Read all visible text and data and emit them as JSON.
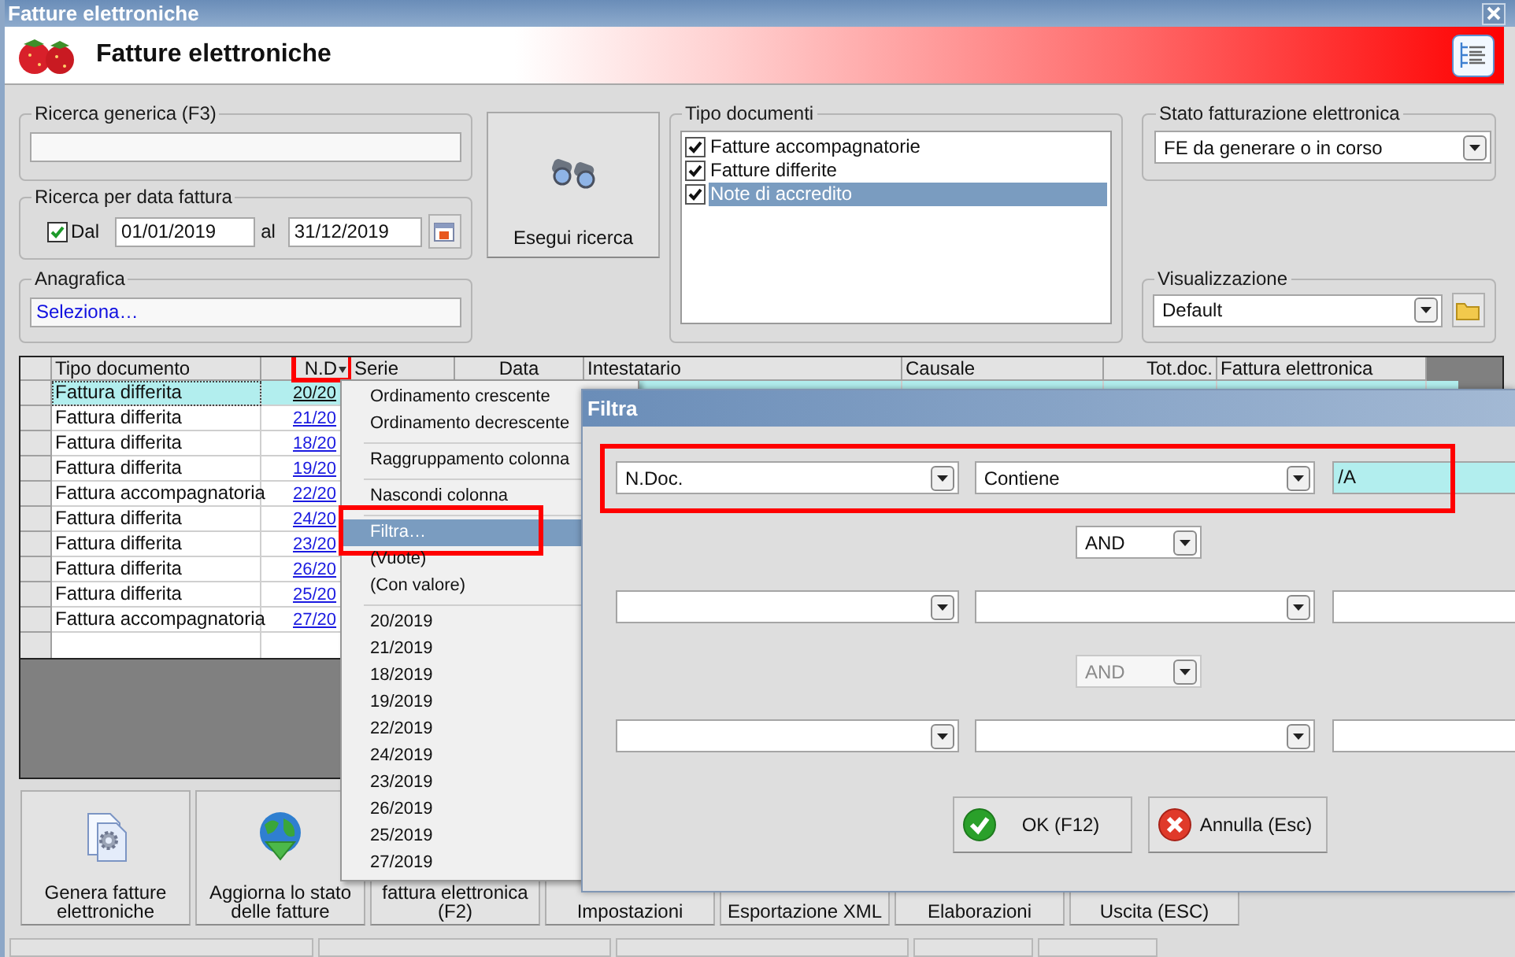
{
  "window": {
    "title": "Fatture elettroniche"
  },
  "header": {
    "title": "Fatture elettroniche"
  },
  "ricerca_generica": {
    "label": "Ricerca generica (F3)"
  },
  "ricerca_data": {
    "label": "Ricerca per data fattura",
    "dal": {
      "label": "Dal",
      "checked": true
    },
    "from": "01/01/2019",
    "al": "al",
    "to": "31/12/2019"
  },
  "anagrafica": {
    "label": "Anagrafica",
    "value": "Seleziona…"
  },
  "search_button": {
    "label": "Esegui ricerca"
  },
  "tipo_documenti": {
    "label": "Tipo documenti",
    "items": [
      {
        "label": "Fatture accompagnatorie",
        "checked": true,
        "selected": false
      },
      {
        "label": "Fatture differite",
        "checked": true,
        "selected": false
      },
      {
        "label": "Note di accredito",
        "checked": true,
        "selected": true
      }
    ]
  },
  "stato": {
    "label": "Stato fatturazione elettronica",
    "value": "FE da generare o in corso"
  },
  "visualizzazione": {
    "label": "Visualizzazione",
    "value": "Default"
  },
  "table": {
    "columns": [
      {
        "label": "Tipo documento",
        "annotated": false
      },
      {
        "label": "N.D",
        "annotated": true
      },
      {
        "label": "Serie",
        "annotated": false
      },
      {
        "label": "Data",
        "annotated": false
      },
      {
        "label": "Intestatario",
        "annotated": false
      },
      {
        "label": "Causale",
        "annotated": false
      },
      {
        "label": "Tot.doc.",
        "annotated": false
      },
      {
        "label": "Fattura elettronica",
        "annotated": false
      }
    ],
    "rows": [
      {
        "tipo": "Fattura differita",
        "n_doc": "20/20",
        "selected": true
      },
      {
        "tipo": "Fattura differita",
        "n_doc": "21/20",
        "selected": false
      },
      {
        "tipo": "Fattura differita",
        "n_doc": "18/20",
        "selected": false
      },
      {
        "tipo": "Fattura differita",
        "n_doc": "19/20",
        "selected": false
      },
      {
        "tipo": "Fattura accompagnatoria",
        "n_doc": "22/20",
        "selected": false
      },
      {
        "tipo": "Fattura differita",
        "n_doc": "24/20",
        "selected": false
      },
      {
        "tipo": "Fattura differita",
        "n_doc": "23/20",
        "selected": false
      },
      {
        "tipo": "Fattura differita",
        "n_doc": "26/20",
        "selected": false
      },
      {
        "tipo": "Fattura differita",
        "n_doc": "25/20",
        "selected": false
      },
      {
        "tipo": "Fattura accompagnatoria",
        "n_doc": "27/20",
        "selected": false
      }
    ]
  },
  "context_menu": {
    "items": [
      {
        "kind": "item",
        "label": "Ordinamento crescente",
        "selected": false,
        "annotated": false
      },
      {
        "kind": "item",
        "label": "Ordinamento decrescente",
        "selected": false,
        "annotated": false
      },
      {
        "kind": "separator"
      },
      {
        "kind": "item",
        "label": "Raggruppamento colonna",
        "selected": false,
        "annotated": false
      },
      {
        "kind": "separator"
      },
      {
        "kind": "item",
        "label": "Nascondi colonna",
        "selected": false,
        "annotated": false
      },
      {
        "kind": "separator"
      },
      {
        "kind": "item",
        "label": "Filtra…",
        "selected": true,
        "annotated": true
      },
      {
        "kind": "item",
        "label": "(Vuote)",
        "selected": false,
        "annotated": false
      },
      {
        "kind": "item",
        "label": "(Con valore)",
        "selected": false,
        "annotated": false
      },
      {
        "kind": "separator"
      },
      {
        "kind": "item",
        "label": "20/2019",
        "selected": false,
        "annotated": false
      },
      {
        "kind": "item",
        "label": "21/2019",
        "selected": false,
        "annotated": false
      },
      {
        "kind": "item",
        "label": "18/2019",
        "selected": false,
        "annotated": false
      },
      {
        "kind": "item",
        "label": "19/2019",
        "selected": false,
        "annotated": false
      },
      {
        "kind": "item",
        "label": "22/2019",
        "selected": false,
        "annotated": false
      },
      {
        "kind": "item",
        "label": "24/2019",
        "selected": false,
        "annotated": false
      },
      {
        "kind": "item",
        "label": "23/2019",
        "selected": false,
        "annotated": false
      },
      {
        "kind": "item",
        "label": "26/2019",
        "selected": false,
        "annotated": false
      },
      {
        "kind": "item",
        "label": "25/2019",
        "selected": false,
        "annotated": false
      },
      {
        "kind": "item",
        "label": "27/2019",
        "selected": false,
        "annotated": false
      }
    ]
  },
  "filter_dialog": {
    "title": "Filtra",
    "rows": [
      {
        "kind": "condition",
        "field": "N.Doc.",
        "operator": "Contiene",
        "value": "/A",
        "annotated": true
      },
      {
        "kind": "connector",
        "value": "AND",
        "disabled": false
      },
      {
        "kind": "condition",
        "annotated": false
      },
      {
        "kind": "connector",
        "value": "AND",
        "disabled": true
      },
      {
        "kind": "condition",
        "annotated": false
      }
    ],
    "buttons": [
      {
        "kind": "ok",
        "label": "OK (F12)"
      },
      {
        "kind": "cancel",
        "label": "Annulla (Esc)"
      }
    ]
  },
  "bottom_buttons": [
    {
      "kind": "generate",
      "lines": [
        "Genera fatture",
        "elettroniche"
      ]
    },
    {
      "kind": "update",
      "lines": [
        "Aggiorna lo stato",
        "delle fatture"
      ]
    },
    {
      "kind": "covered",
      "lines": [
        "fattura elettronica",
        "(F2)"
      ]
    },
    {
      "kind": "covered",
      "lines": [
        "Impostazioni"
      ]
    },
    {
      "kind": "covered",
      "lines": [
        "Esportazione XML"
      ]
    },
    {
      "kind": "covered",
      "lines": [
        "Elaborazioni"
      ]
    },
    {
      "kind": "covered",
      "lines": [
        "Uscita (ESC)"
      ]
    }
  ]
}
